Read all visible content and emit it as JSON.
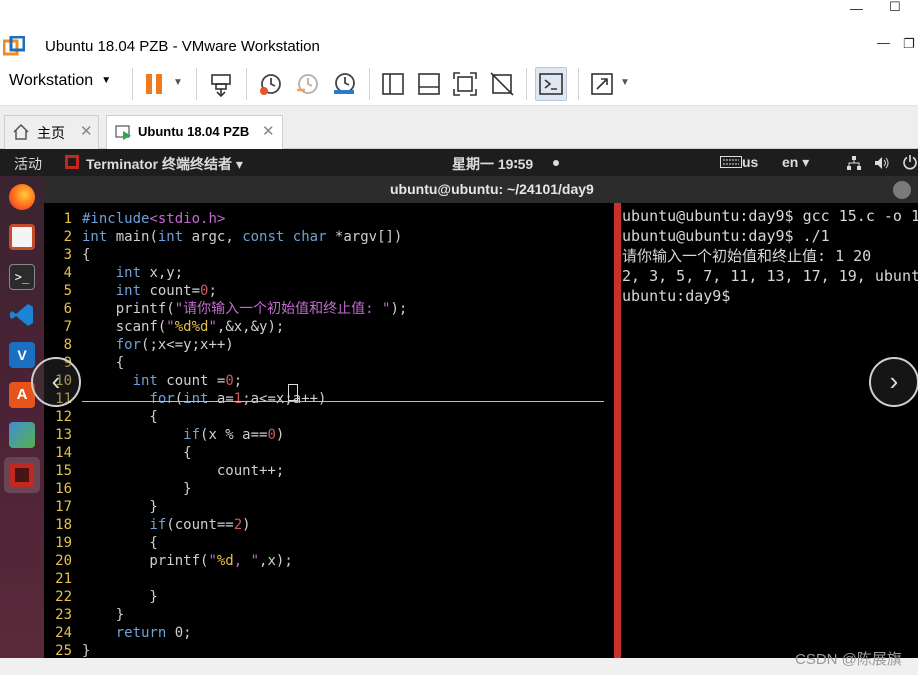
{
  "window": {
    "title": "Ubuntu 18.04 PZB - VMware Workstation",
    "min_glyph": "—",
    "max_glyph": "☐",
    "restore_min_glyph": "—",
    "restore_glyph": "❐"
  },
  "toolbar": {
    "menu_label": "Workstation",
    "menu_caret": "▼",
    "pause_caret": "▼",
    "fullscreen_caret": "▼",
    "icons": [
      "pause-icon",
      "send-ctrl-alt-del-icon",
      "snapshot-icon",
      "revert-snapshot-icon",
      "snapshot-manager-icon",
      "library-icon",
      "thumbnail-icon",
      "fit-guest-icon",
      "unity-icon",
      "console-view-icon",
      "fullscreen-icon"
    ]
  },
  "tabs": [
    {
      "label": "主页",
      "close": "✕"
    },
    {
      "label": "Ubuntu 18.04 PZB",
      "close": "✕"
    }
  ],
  "guest_topbar": {
    "activities": "活动",
    "app_menu": "Terminator 终端终结者 ▾",
    "clock": "星期一 19∶59",
    "keyboard": "us",
    "language": "en ▾"
  },
  "terminal": {
    "title": "ubuntu@ubuntu: ~/24101/day9",
    "code": [
      {
        "n": "1",
        "t": "#include<stdio.h>"
      },
      {
        "n": "2",
        "t": "int main(int argc, const char *argv[])"
      },
      {
        "n": "3",
        "t": "{"
      },
      {
        "n": "4",
        "t": "    int x,y;"
      },
      {
        "n": "5",
        "t": "    int count=0;"
      },
      {
        "n": "6",
        "t": "    printf(\"请你输入一个初始值和终止值: \");"
      },
      {
        "n": "7",
        "t": "    scanf(\"%d%d\",&x,&y);"
      },
      {
        "n": "8",
        "t": "    for(;x<=y;x++)"
      },
      {
        "n": "9",
        "t": "    {"
      },
      {
        "n": "10",
        "t": "      int count =0;"
      },
      {
        "n": "11",
        "t": "        for(int a=1;a<=x;a++)"
      },
      {
        "n": "12",
        "t": "        {"
      },
      {
        "n": "13",
        "t": "            if(x % a==0)"
      },
      {
        "n": "14",
        "t": "            {"
      },
      {
        "n": "15",
        "t": "                count++;"
      },
      {
        "n": "16",
        "t": "            }"
      },
      {
        "n": "17",
        "t": "        }"
      },
      {
        "n": "18",
        "t": "        if(count==2)"
      },
      {
        "n": "19",
        "t": "        {"
      },
      {
        "n": "20",
        "t": "        printf(\"%d, \",x);"
      },
      {
        "n": "21",
        "t": ""
      },
      {
        "n": "22",
        "t": "        }"
      },
      {
        "n": "23",
        "t": "    }"
      },
      {
        "n": "24",
        "t": "    return 0;"
      },
      {
        "n": "25",
        "t": "}"
      }
    ],
    "shell": [
      "ubuntu@ubuntu:day9$ gcc 15.c -o 1",
      "ubuntu@ubuntu:day9$ ./1",
      "请你输入一个初始值和终止值: 1 20",
      "2, 3, 5, 7, 11, 13, 17, 19, ubunt",
      "ubuntu:day9$"
    ]
  },
  "watermark": "CSDN @陈展旗",
  "colors": {
    "line_number": "#e6c04a",
    "keyword": "#6fa0d8",
    "string": "#c36ad0",
    "number": "#cf5a5a",
    "divider": "#c8302a"
  }
}
